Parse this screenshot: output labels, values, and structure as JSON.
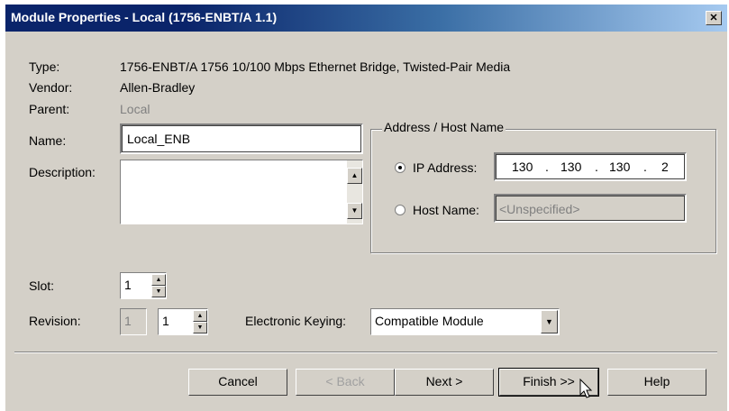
{
  "window": {
    "title": "Module Properties - Local (1756-ENBT/A 1.1)",
    "close_glyph": "✕"
  },
  "info": {
    "type_label": "Type:",
    "type_value": "1756-ENBT/A 1756 10/100 Mbps Ethernet Bridge, Twisted-Pair Media",
    "vendor_label": "Vendor:",
    "vendor_value": "Allen-Bradley",
    "parent_label": "Parent:",
    "parent_value": "Local"
  },
  "name": {
    "label": "Name:",
    "value": "Local_ENB"
  },
  "description": {
    "label": "Description:",
    "value": ""
  },
  "address": {
    "group_label": "Address / Host Name",
    "ip_option_label": "IP Address:",
    "ip_selected": true,
    "ip_octets": [
      "130",
      "130",
      "130",
      "2"
    ],
    "ip_dot": ".",
    "host_option_label": "Host Name:",
    "host_placeholder": "<Unspecified>"
  },
  "slot": {
    "label": "Slot:",
    "value": "1"
  },
  "revision": {
    "label": "Revision:",
    "major": "1",
    "minor": "1"
  },
  "keying": {
    "label": "Electronic Keying:",
    "selected": "Compatible Module"
  },
  "buttons": {
    "cancel": "Cancel",
    "back": "< Back",
    "next": "Next >",
    "finish": "Finish >>",
    "help": "Help"
  },
  "icons": {
    "spin_up": "▲",
    "spin_down": "▼",
    "dropdown": "▼"
  }
}
